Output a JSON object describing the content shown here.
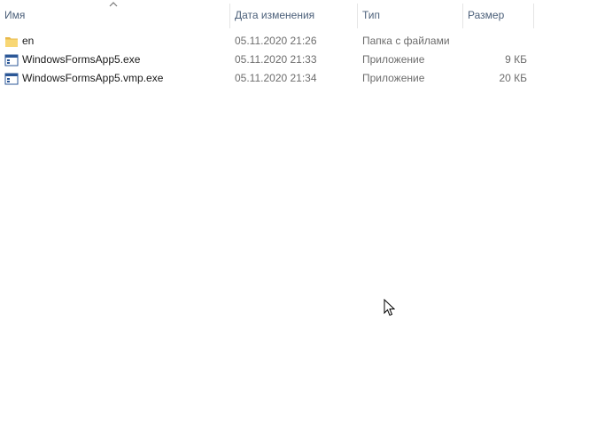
{
  "columns": {
    "name": "Имя",
    "date": "Дата изменения",
    "type": "Тип",
    "size": "Размер"
  },
  "sort": {
    "column": "name",
    "direction": "ascending",
    "icon": "chevron-up-icon"
  },
  "files": [
    {
      "icon": "folder-icon",
      "name": "en",
      "date": "05.11.2020 21:26",
      "type": "Папка с файлами",
      "size": ""
    },
    {
      "icon": "application-icon",
      "name": "WindowsFormsApp5.exe",
      "date": "05.11.2020 21:33",
      "type": "Приложение",
      "size": "9 КБ"
    },
    {
      "icon": "application-icon",
      "name": "WindowsFormsApp5.vmp.exe",
      "date": "05.11.2020 21:34",
      "type": "Приложение",
      "size": "20 КБ"
    }
  ],
  "colors": {
    "header_text": "#4c607a",
    "secondary_text": "#6d6d6d",
    "folder_yellow": "#f8d775",
    "app_icon_blue": "#2b5797"
  }
}
